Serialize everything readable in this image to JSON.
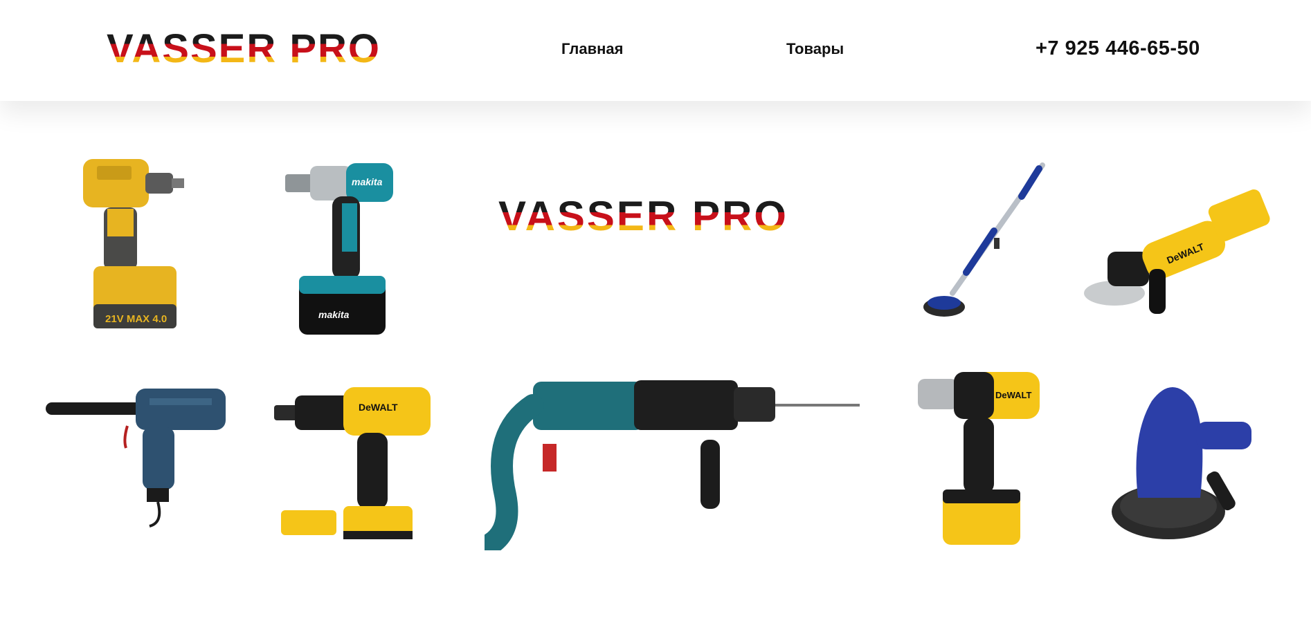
{
  "header": {
    "logo_text": "VASSER PRO",
    "nav": [
      {
        "label": "Главная"
      },
      {
        "label": "Товары"
      }
    ],
    "phone": "+7 925 446-65-50"
  },
  "hero": {
    "center_logo_text": "VASSER PRO",
    "products": [
      {
        "name": "impact-wrench-yellow",
        "battery_label": "21V MAX 4.0"
      },
      {
        "name": "impact-wrench-makita",
        "brand": "makita"
      },
      {
        "name": "drywall-sander-pole"
      },
      {
        "name": "angle-grinder-dewalt",
        "brand": "DeWALT"
      },
      {
        "name": "rivet-gun"
      },
      {
        "name": "drill-dewalt",
        "brand": "DeWALT"
      },
      {
        "name": "rotary-hammer"
      },
      {
        "name": "impact-wrench-dewalt",
        "brand": "DeWALT"
      },
      {
        "name": "drywall-sander-blue"
      }
    ]
  },
  "colors": {
    "logo_black": "#1b1b1b",
    "logo_red": "#c8101a",
    "logo_yellow": "#f3b716",
    "dewalt_yellow": "#f5c518",
    "makita_teal": "#1a8fa0"
  }
}
